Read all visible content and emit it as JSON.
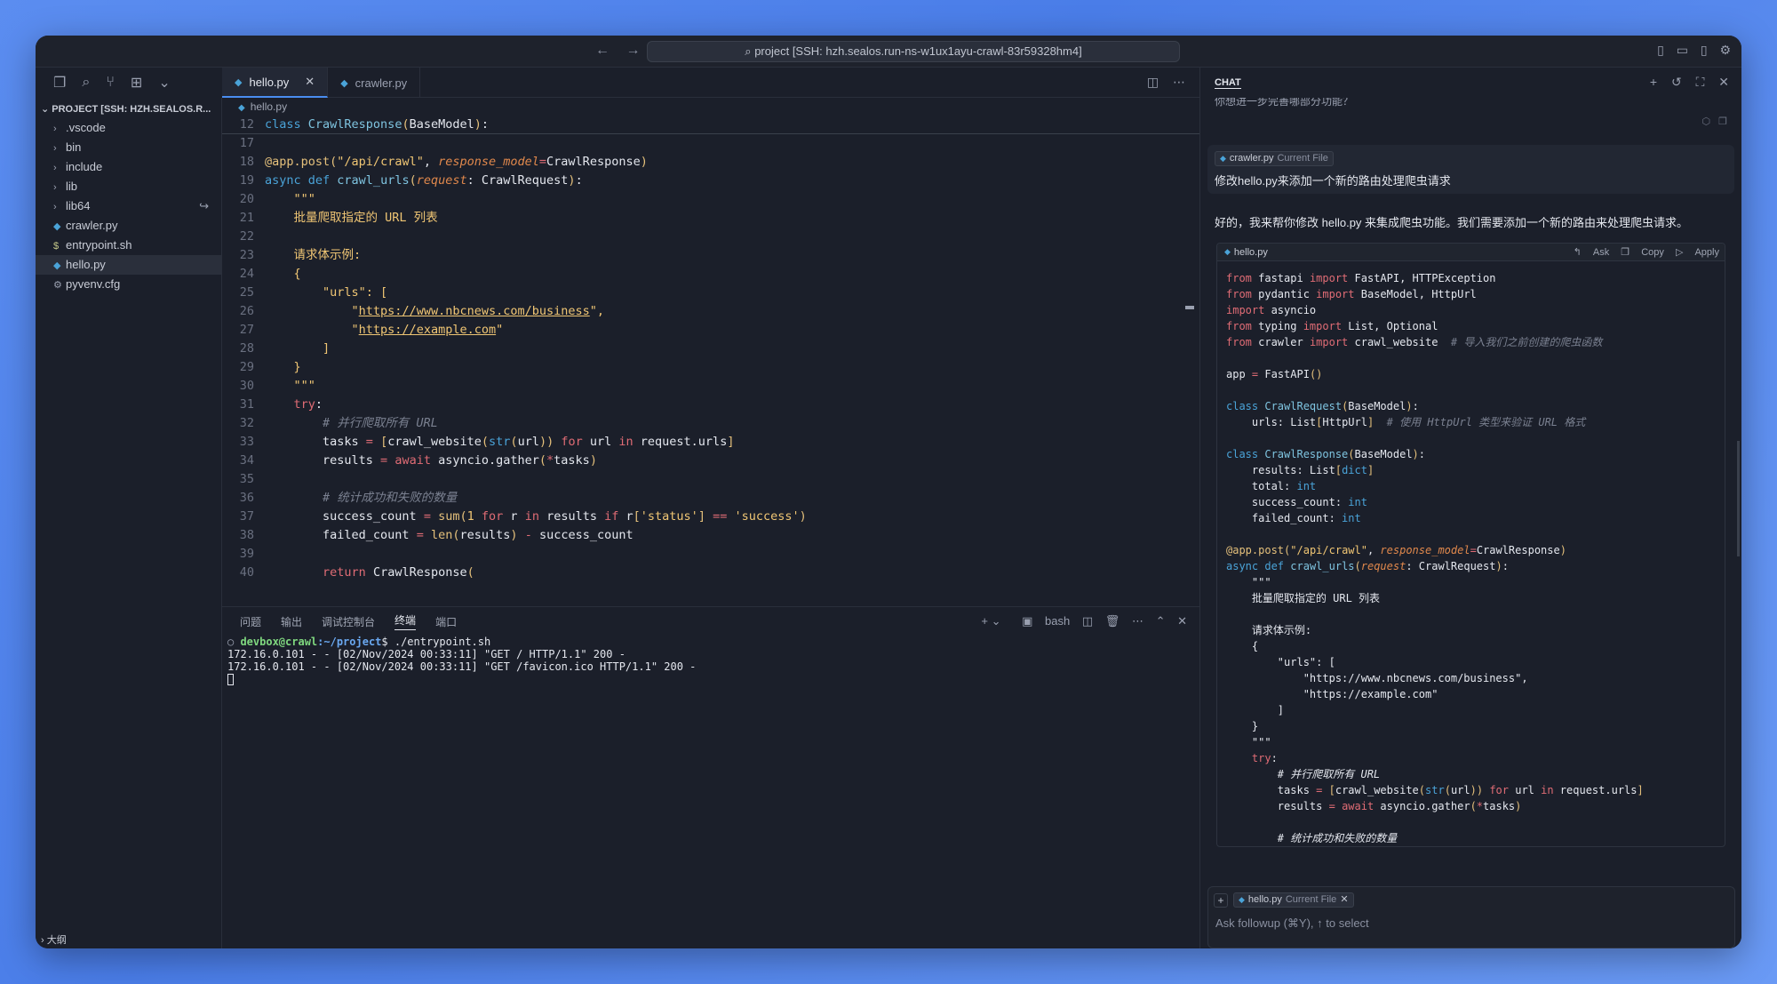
{
  "titlebar": {
    "back": "←",
    "forward": "→",
    "command_center": "project [SSH: hzh.sealos.run-ns-w1ux1ayu-crawl-83r59328hm4]"
  },
  "sidebar": {
    "project_title": "PROJECT [SSH: HZH.SEALOS.R...",
    "items": [
      {
        "label": ".vscode",
        "type": "folder"
      },
      {
        "label": "bin",
        "type": "folder"
      },
      {
        "label": "include",
        "type": "folder"
      },
      {
        "label": "lib",
        "type": "folder"
      },
      {
        "label": "lib64",
        "type": "folder"
      },
      {
        "label": "crawler.py",
        "type": "py"
      },
      {
        "label": "entrypoint.sh",
        "type": "sh"
      },
      {
        "label": "hello.py",
        "type": "py"
      },
      {
        "label": "pyvenv.cfg",
        "type": "cfg"
      }
    ],
    "bottom_section": "大纲"
  },
  "tabs": [
    {
      "label": "hello.py",
      "active": true
    },
    {
      "label": "crawler.py",
      "active": false
    }
  ],
  "breadcrumb": "hello.py",
  "editor": {
    "line_numbers": [
      "12",
      "17",
      "18",
      "19",
      "20",
      "21",
      "22",
      "23",
      "24",
      "25",
      "26",
      "27",
      "28",
      "29",
      "30",
      "31",
      "32",
      "33",
      "34",
      "35",
      "36",
      "37",
      "38",
      "39",
      "40"
    ]
  },
  "panel": {
    "tabs": [
      "问题",
      "输出",
      "调试控制台",
      "终端",
      "端口"
    ],
    "active_tab": "终端",
    "shell": "bash",
    "terminal": {
      "user": "devbox@crawl",
      "path": ":~/project",
      "command": "$ ./entrypoint.sh",
      "lines": [
        "172.16.0.101 - - [02/Nov/2024 00:33:11] \"GET / HTTP/1.1\" 200 -",
        "172.16.0.101 - - [02/Nov/2024 00:33:11] \"GET /favicon.ico HTTP/1.1\" 200 -"
      ]
    }
  },
  "chat": {
    "title": "CHAT",
    "cut_text": "你想进一步完善哪部分功能？",
    "user_chip_file": "crawler.py",
    "user_chip_sub": "Current File",
    "user_message": "修改hello.py来添加一个新的路由处理爬虫请求",
    "ai_message": "好的，我来帮你修改 hello.py 来集成爬虫功能。我们需要添加一个新的路由来处理爬虫请求。",
    "codeblock_file": "hello.py",
    "codeblock_actions": {
      "ask": "Ask",
      "copy": "Copy",
      "apply": "Apply"
    },
    "input_chip_file": "hello.py",
    "input_chip_sub": "Current File",
    "input_placeholder": "Ask followup (⌘Y), ↑ to select"
  },
  "colors": {
    "background": "#1b1f2a",
    "accent": "#4a8df0",
    "keyword": "#e06c75",
    "string": "#f0c674"
  }
}
